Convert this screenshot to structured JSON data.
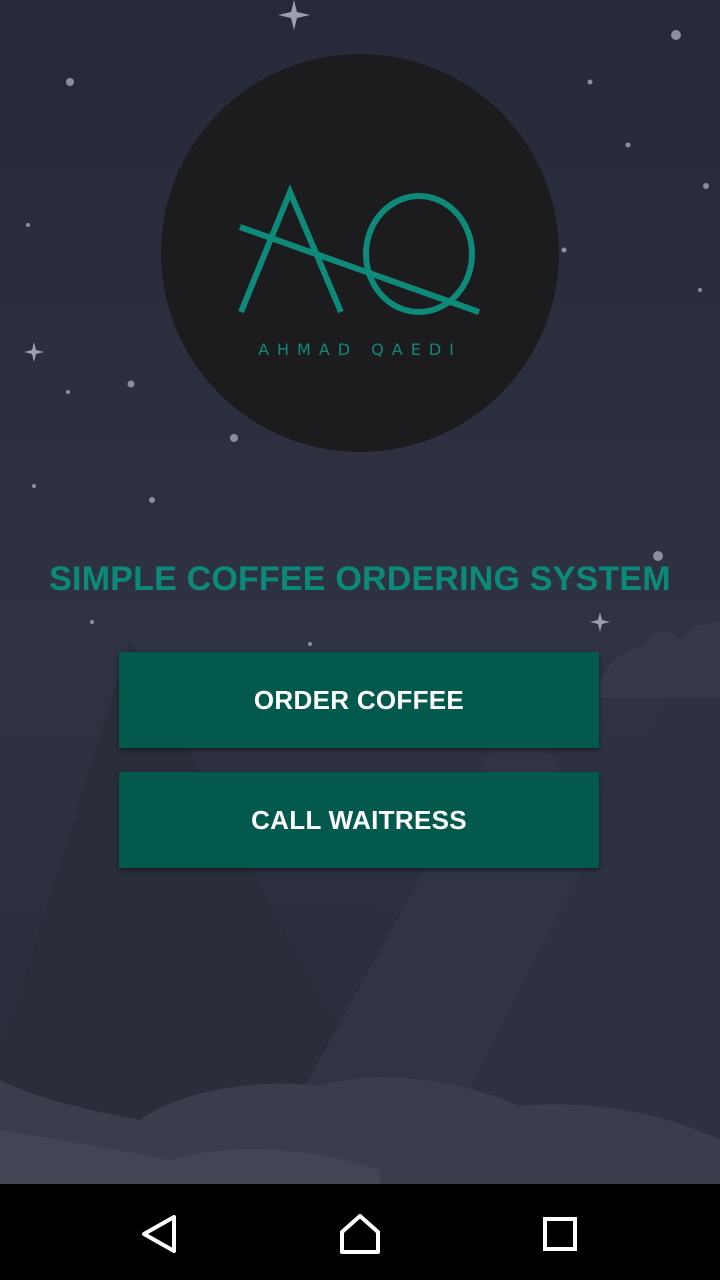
{
  "logo": {
    "monogram": "AQ",
    "name": "AHMAD QAEDI"
  },
  "app": {
    "title": "SIMPLE COFFEE ORDERING SYSTEM"
  },
  "buttons": {
    "order_coffee": "ORDER COFFEE",
    "call_waitress": "CALL WAITRESS"
  },
  "navigation": {
    "back": "back-icon",
    "home": "home-icon",
    "recents": "recents-icon"
  },
  "colors": {
    "accent": "#0b8a79",
    "button_bg": "#035a4c",
    "logo_bg": "#1c1c1e",
    "background": "#2c303d"
  }
}
